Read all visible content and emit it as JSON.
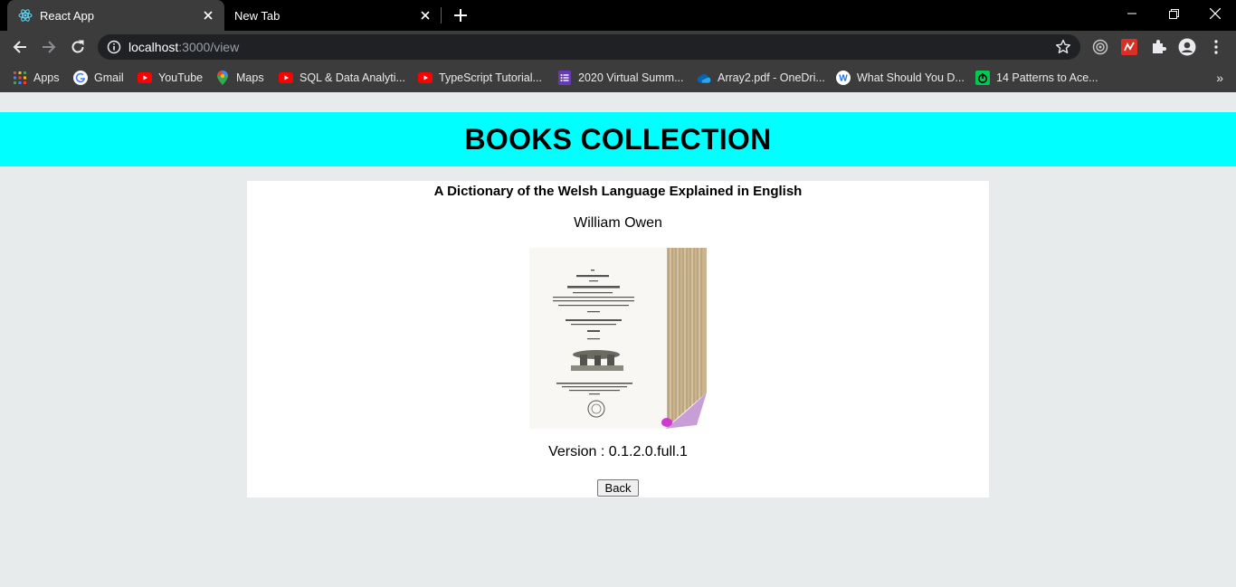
{
  "browser": {
    "tabs": [
      {
        "label": "React App",
        "icon": "react-icon",
        "active": true
      },
      {
        "label": "New Tab",
        "icon": "",
        "active": false
      }
    ],
    "url_host": "localhost",
    "url_path": ":3000/view",
    "bookmarks": [
      {
        "label": "Apps",
        "icon": "apps-grid-icon"
      },
      {
        "label": "Gmail",
        "icon": "google-icon"
      },
      {
        "label": "YouTube",
        "icon": "youtube-icon"
      },
      {
        "label": "Maps",
        "icon": "maps-pin-icon"
      },
      {
        "label": "SQL & Data Analyti...",
        "icon": "youtube-icon"
      },
      {
        "label": "TypeScript Tutorial...",
        "icon": "youtube-icon"
      },
      {
        "label": "2020 Virtual Summ...",
        "icon": "forms-icon"
      },
      {
        "label": "Array2.pdf - OneDri...",
        "icon": "onedrive-icon"
      },
      {
        "label": "What Should You D...",
        "icon": "w-circle-icon"
      },
      {
        "label": "14 Patterns to Ace...",
        "icon": "green-power-icon"
      }
    ]
  },
  "page": {
    "heading": "BOOKS COLLECTION",
    "book": {
      "title": "A Dictionary of the Welsh Language Explained in English",
      "author": "William Owen",
      "version_text": "Version : 0.1.2.0.full.1",
      "cover_lines": [
        "A",
        "DICTIONARY",
        "OF THE",
        "WELSH LANGUAGE,",
        "EXPLAINED IN ENGLISH",
        "VOL. II."
      ]
    },
    "back_label": "Back"
  },
  "colors": {
    "banner": "#00ffff",
    "page_bg": "#e8ebec",
    "card_bg": "#ffffff",
    "chrome_dark": "#3c3c3c"
  }
}
